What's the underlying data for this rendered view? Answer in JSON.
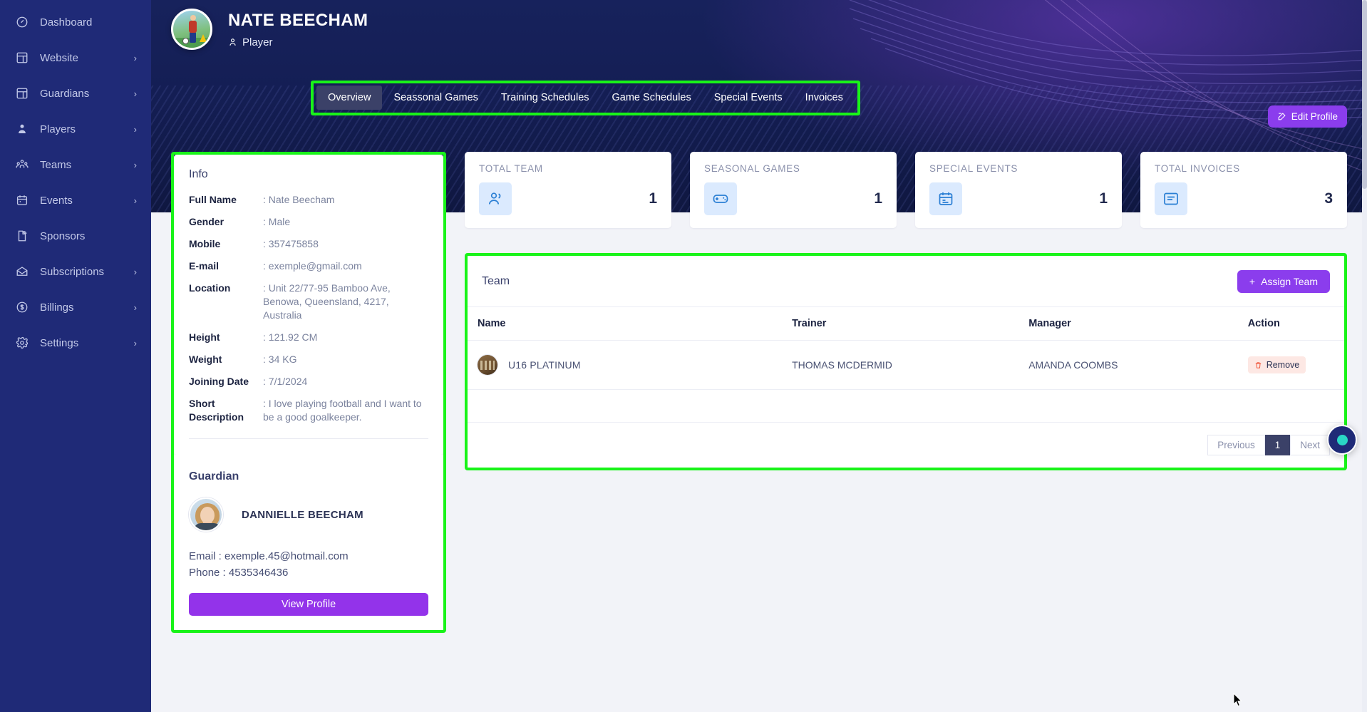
{
  "sidebar": {
    "items": [
      {
        "label": "Dashboard",
        "icon": "dashboard-icon",
        "chevron": false
      },
      {
        "label": "Website",
        "icon": "layout-icon",
        "chevron": true
      },
      {
        "label": "Guardians",
        "icon": "layout-icon",
        "chevron": true
      },
      {
        "label": "Players",
        "icon": "user-icon",
        "chevron": true
      },
      {
        "label": "Teams",
        "icon": "users-group-icon",
        "chevron": true
      },
      {
        "label": "Events",
        "icon": "calendar-icon",
        "chevron": true
      },
      {
        "label": "Sponsors",
        "icon": "file-signal-icon",
        "chevron": false
      },
      {
        "label": "Subscriptions",
        "icon": "envelope-icon",
        "chevron": true
      },
      {
        "label": "Billings",
        "icon": "dollar-circle-icon",
        "chevron": true
      },
      {
        "label": "Settings",
        "icon": "gear-icon",
        "chevron": true
      }
    ],
    "chevron_glyph": "›"
  },
  "header": {
    "name": "NATE BEECHAM",
    "role": "Player",
    "edit_profile_label": "Edit Profile"
  },
  "tabs": [
    {
      "label": "Overview",
      "active": true
    },
    {
      "label": "Seassonal Games",
      "active": false
    },
    {
      "label": "Training Schedules",
      "active": false
    },
    {
      "label": "Game Schedules",
      "active": false
    },
    {
      "label": "Special Events",
      "active": false
    },
    {
      "label": "Invoices",
      "active": false
    }
  ],
  "info": {
    "title": "Info",
    "rows": [
      {
        "key": "Full Name",
        "value": ": Nate Beecham"
      },
      {
        "key": "Gender",
        "value": ": Male"
      },
      {
        "key": "Mobile",
        "value": ": 357475858"
      },
      {
        "key": "E-mail",
        "value": ": exemple@gmail.com"
      },
      {
        "key": "Location",
        "value": ": Unit 22/77-95 Bamboo Ave, Benowa, Queensland, 4217, Australia"
      },
      {
        "key": "Height",
        "value": ": 121.92 CM"
      },
      {
        "key": "Weight",
        "value": ": 34 KG"
      },
      {
        "key": "Joining Date",
        "value": ": 7/1/2024"
      },
      {
        "key": "Short Description",
        "value": ": I love playing football and I want to be a good goalkeeper."
      }
    ]
  },
  "guardian": {
    "title": "Guardian",
    "name": "DANNIELLE BEECHAM",
    "email": "Email : exemple.45@hotmail.com",
    "phone": "Phone : 4535346436",
    "view_profile_label": "View Profile"
  },
  "stats": [
    {
      "label": "TOTAL TEAM",
      "value": "1",
      "icon": "people-icon"
    },
    {
      "label": "SEASONAL GAMES",
      "value": "1",
      "icon": "gamepad-icon"
    },
    {
      "label": "SPECIAL EVENTS",
      "value": "1",
      "icon": "calendar-icon"
    },
    {
      "label": "TOTAL INVOICES",
      "value": "3",
      "icon": "invoice-icon"
    }
  ],
  "team_panel": {
    "title": "Team",
    "assign_label": "Assign Team",
    "assign_plus": "+",
    "columns": [
      "Name",
      "Trainer",
      "Manager",
      "Action"
    ],
    "rows": [
      {
        "name": "U16 PLATINUM",
        "trainer": "THOMAS MCDERMID",
        "manager": "AMANDA COOMBS",
        "action": "Remove"
      }
    ],
    "pagination": {
      "previous": "Previous",
      "current": "1",
      "next": "Next"
    }
  },
  "colors": {
    "sidebar_bg": "#1f2a77",
    "accent_purple": "#8b3ded",
    "highlight_green": "#19f319",
    "stat_icon_blue": "#2b7fd4",
    "remove_red": "#ef4c2f"
  }
}
